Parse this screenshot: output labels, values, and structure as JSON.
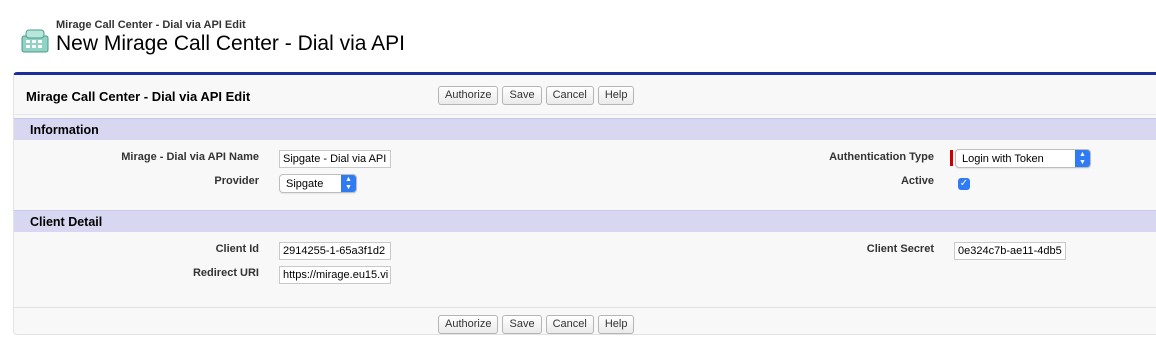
{
  "header": {
    "subtitle": "Mirage Call Center - Dial via API Edit",
    "title": "New Mirage Call Center - Dial via API",
    "icon": "call-center-icon"
  },
  "panel": {
    "title": "Mirage Call Center - Dial via API Edit",
    "buttons": {
      "authorize": "Authorize",
      "save": "Save",
      "cancel": "Cancel",
      "help": "Help"
    }
  },
  "sections": {
    "information": {
      "title": "Information",
      "name_label": "Mirage - Dial via API Name",
      "name_value": "Sipgate - Dial via API",
      "provider_label": "Provider",
      "provider_value": "Sipgate",
      "auth_type_label": "Authentication Type",
      "auth_type_value": "Login with Token",
      "active_label": "Active",
      "active_checked": true
    },
    "client_detail": {
      "title": "Client Detail",
      "client_id_label": "Client Id",
      "client_id_value": "2914255-1-65a3f1d2",
      "redirect_uri_label": "Redirect URI",
      "redirect_uri_value": "https://mirage.eu15.vi",
      "client_secret_label": "Client Secret",
      "client_secret_value": "0e324c7b-ae11-4db5"
    }
  },
  "colors": {
    "accent": "#1f2d9c",
    "section_header": "#d7d7f2",
    "select_blue": "#2f7bf3",
    "required": "#cc0000"
  }
}
